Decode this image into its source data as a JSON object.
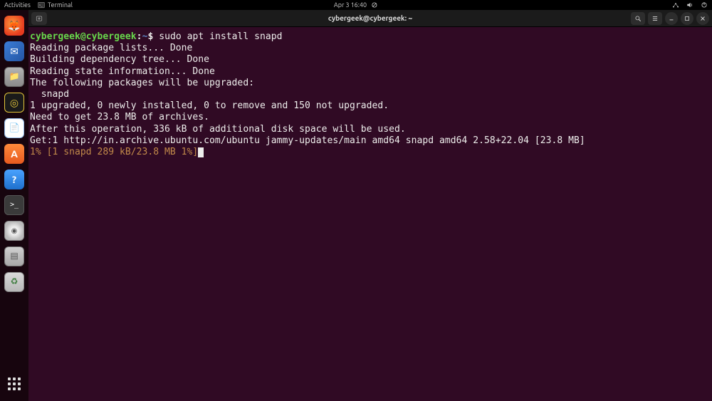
{
  "topbar": {
    "activities": "Activities",
    "app_name": "Terminal",
    "clock": "Apr 3  16:40"
  },
  "titlebar": {
    "title": "cybergeek@cybergeek: ~"
  },
  "dock": {
    "items": [
      {
        "name": "firefox",
        "glyph": "🦊"
      },
      {
        "name": "thunderbird",
        "glyph": "✉"
      },
      {
        "name": "files",
        "glyph": "📁"
      },
      {
        "name": "rhythmbox",
        "glyph": "◎"
      },
      {
        "name": "writer",
        "glyph": "📄"
      },
      {
        "name": "software",
        "glyph": "A"
      },
      {
        "name": "help",
        "glyph": "?"
      },
      {
        "name": "terminal",
        "glyph": ">_"
      },
      {
        "name": "disk",
        "glyph": "◉"
      },
      {
        "name": "drive",
        "glyph": "▤"
      },
      {
        "name": "trash",
        "glyph": "♻"
      }
    ]
  },
  "terminal": {
    "prompt": {
      "user_host": "cybergeek@cybergeek",
      "separator": ":",
      "path": "~",
      "symbol": "$"
    },
    "command": "sudo apt install snapd",
    "output": [
      "Reading package lists... Done",
      "Building dependency tree... Done",
      "Reading state information... Done",
      "The following packages will be upgraded:",
      "  snapd",
      "1 upgraded, 0 newly installed, 0 to remove and 150 not upgraded.",
      "Need to get 23.8 MB of archives.",
      "After this operation, 336 kB of additional disk space will be used.",
      "Get:1 http://in.archive.ubuntu.com/ubuntu jammy-updates/main amd64 snapd amd64 2.58+22.04 [23.8 MB]"
    ],
    "progress": "1% [1 snapd 289 kB/23.8 MB 1%]"
  }
}
